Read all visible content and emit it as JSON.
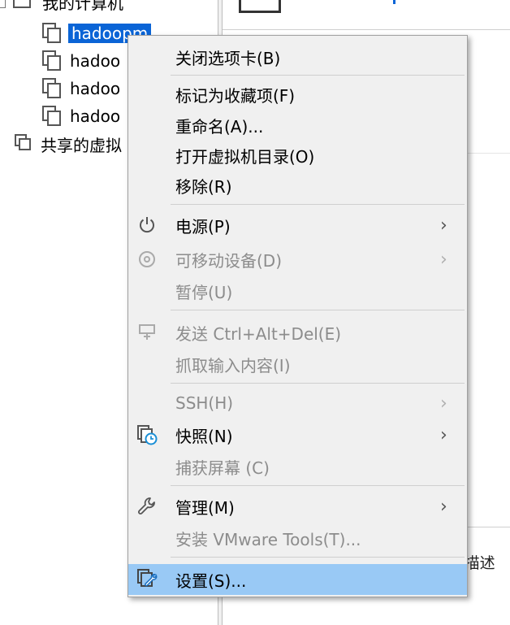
{
  "tree": {
    "root_label": "我的计算机",
    "items": [
      {
        "label": "hadoopm",
        "selected": true
      },
      {
        "label": "hadoo",
        "selected": false
      },
      {
        "label": "hadoo",
        "selected": false
      },
      {
        "label": "hadoo",
        "selected": false
      }
    ],
    "shared_label": "共享的虚拟"
  },
  "right_panel": {
    "description_fragment": "J描述"
  },
  "context_menu": {
    "close_tab": "关闭选项卡(B)",
    "mark_favorite": "标记为收藏项(F)",
    "rename": "重命名(A)...",
    "open_vm_dir": "打开虚拟机目录(O)",
    "remove": "移除(R)",
    "power": "电源(P)",
    "removable_devices": "可移动设备(D)",
    "pause": "暂停(U)",
    "send_cad": "发送 Ctrl+Alt+Del(E)",
    "grab_input": "抓取输入内容(I)",
    "ssh": "SSH(H)",
    "snapshot": "快照(N)",
    "capture_screen": "捕获屏幕 (C)",
    "manage": "管理(M)",
    "install_tools": "安装 VMware Tools(T)...",
    "settings": "设置(S)...",
    "submenu_arrow": "›"
  },
  "colors": {
    "selection": "#0a64d6",
    "menu_highlight": "#99c9f5",
    "menu_bg": "#f0f0f0",
    "disabled_text": "#8c8c8c"
  }
}
